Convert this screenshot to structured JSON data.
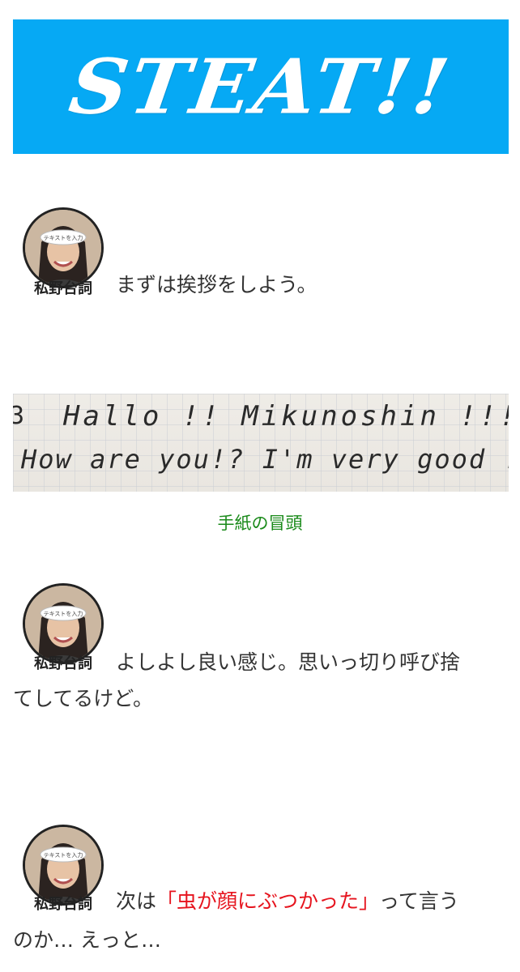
{
  "banner": {
    "title": "STEAT!!"
  },
  "avatar_label": "テキストを入力",
  "blocks": [
    {
      "speaker": "私野台詞",
      "line1": "まずは挨拶をしよう。"
    },
    {
      "speaker": "私野台詞",
      "line1": "よしよし良い感じ。思いっ切り呼び捨",
      "line2": "てしてるけど。"
    },
    {
      "speaker": "私野台詞",
      "line1_pre": "次は",
      "line1_highlight": "「虫が顔にぶつかった」",
      "line1_post": "って言う",
      "line2": "のか… えっと…"
    }
  ],
  "photo": {
    "margin_mark": "3",
    "handwriting_line1": "Hallo !! Mikunoshin !!!",
    "handwriting_line2": "How are you!?  I'm very  good !!"
  },
  "caption": "手紙の冒頭",
  "colors": {
    "banner_bg": "#06a9f4",
    "caption": "#1a8a1a",
    "highlight": "#e6141e"
  }
}
